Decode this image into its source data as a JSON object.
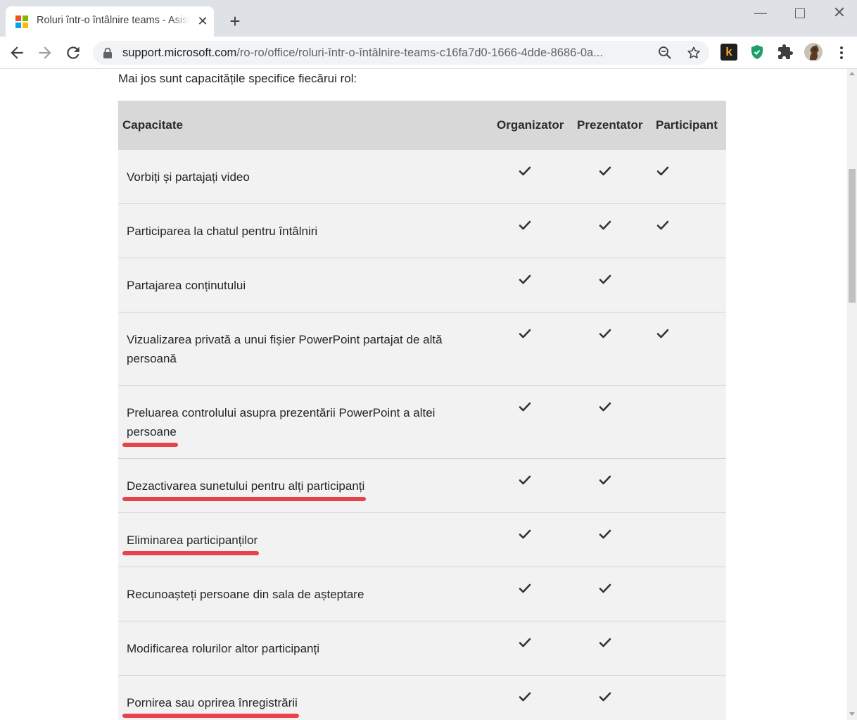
{
  "browser": {
    "tab": {
      "title": "Roluri într-o întâlnire teams - Asistență Office"
    },
    "new_tab_symbol": "+",
    "url": {
      "host": "support.microsoft.com",
      "path": "/ro-ro/office/roluri-într-o-întâlnire-teams-c16fa7d0-1666-4dde-8686-0a..."
    },
    "extensions": {
      "k_label": "k"
    }
  },
  "page": {
    "intro": "Mai jos sunt capacitățile specifice fiecărui rol:",
    "table": {
      "headers": [
        "Capacitate",
        "Organizator",
        "Prezentator",
        "Participant"
      ],
      "rows": [
        {
          "capability": "Vorbiți și partajați video",
          "organizator": true,
          "prezentator": true,
          "participant": true,
          "highlighted": false
        },
        {
          "capability": "Participarea la chatul pentru întâlniri",
          "organizator": true,
          "prezentator": true,
          "participant": true,
          "highlighted": false
        },
        {
          "capability": "Partajarea conținutului",
          "organizator": true,
          "prezentator": true,
          "participant": false,
          "highlighted": false
        },
        {
          "capability": "Vizualizarea privată a unui fișier PowerPoint partajat de altă persoană",
          "organizator": true,
          "prezentator": true,
          "participant": true,
          "highlighted": false
        },
        {
          "capability": "Preluarea controlului asupra prezentării PowerPoint a altei persoane",
          "organizator": true,
          "prezentator": true,
          "participant": false,
          "highlighted": true
        },
        {
          "capability": "Dezactivarea sunetului pentru alți participanți",
          "organizator": true,
          "prezentator": true,
          "participant": false,
          "highlighted": true
        },
        {
          "capability": "Eliminarea participanților",
          "organizator": true,
          "prezentator": true,
          "participant": false,
          "highlighted": true
        },
        {
          "capability": "Recunoașteți persoane din sala de așteptare",
          "organizator": true,
          "prezentator": true,
          "participant": false,
          "highlighted": false
        },
        {
          "capability": "Modificarea rolurilor altor participanți",
          "organizator": true,
          "prezentator": true,
          "participant": false,
          "highlighted": false
        },
        {
          "capability": "Pornirea sau oprirea înregistrării",
          "organizator": true,
          "prezentator": true,
          "participant": false,
          "highlighted": true
        }
      ]
    },
    "annotation_color": "#e8424b"
  }
}
